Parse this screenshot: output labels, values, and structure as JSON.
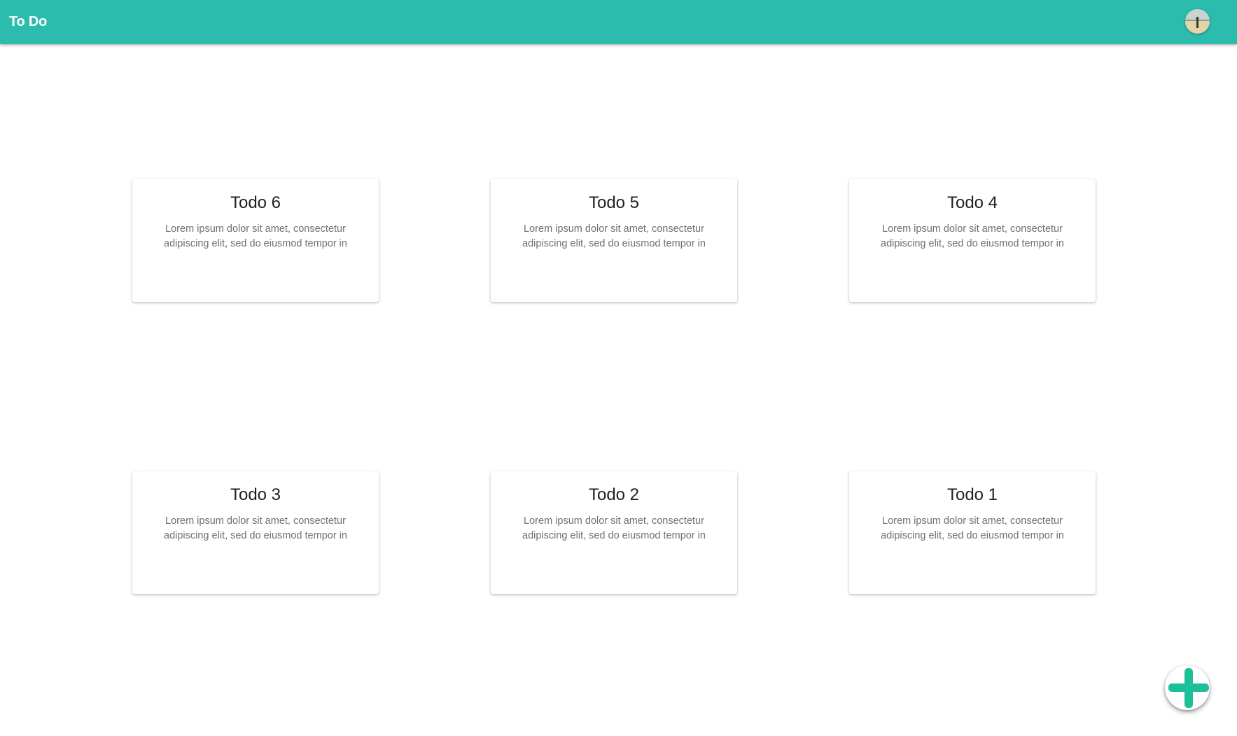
{
  "appbar": {
    "title": "To Do",
    "color": "#2bbcad",
    "avatar_icon": "user-avatar"
  },
  "todos": [
    {
      "title": "Todo 6",
      "description": "Lorem ipsum dolor sit amet, consectetur adipiscing elit, sed do eiusmod tempor in"
    },
    {
      "title": "Todo 5",
      "description": "Lorem ipsum dolor sit amet, consectetur adipiscing elit, sed do eiusmod tempor in"
    },
    {
      "title": "Todo 4",
      "description": "Lorem ipsum dolor sit amet, consectetur adipiscing elit, sed do eiusmod tempor in"
    },
    {
      "title": "Todo 3",
      "description": "Lorem ipsum dolor sit amet, consectetur adipiscing elit, sed do eiusmod tempor in"
    },
    {
      "title": "Todo 2",
      "description": "Lorem ipsum dolor sit amet, consectetur adipiscing elit, sed do eiusmod tempor in"
    },
    {
      "title": "Todo 1",
      "description": "Lorem ipsum dolor sit amet, consectetur adipiscing elit, sed do eiusmod tempor in"
    }
  ],
  "fab": {
    "icon": "plus-icon",
    "color": "#1dbf99"
  }
}
